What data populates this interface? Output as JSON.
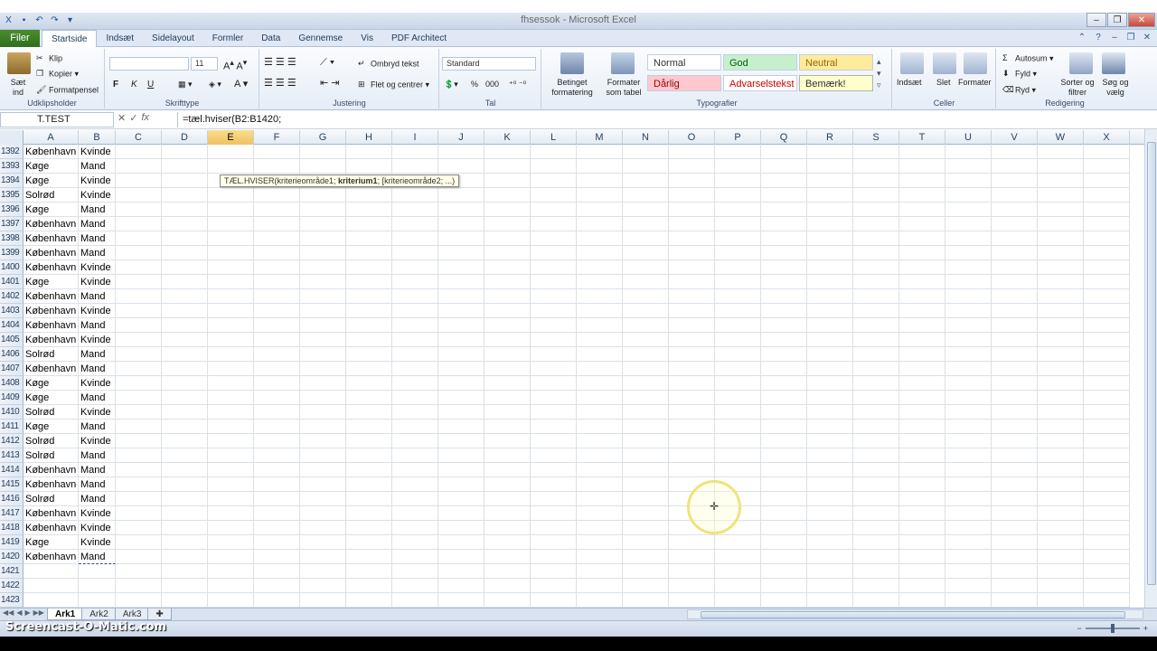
{
  "window": {
    "title": "fhsessok - Microsoft Excel",
    "controls": [
      "minimize",
      "restore",
      "close"
    ]
  },
  "ribbon_tabs": {
    "file": "Filer",
    "tabs": [
      "Startside",
      "Indsæt",
      "Sidelayout",
      "Formler",
      "Data",
      "Gennemse",
      "Vis",
      "PDF Architect"
    ],
    "active": "Startside"
  },
  "ribbon": {
    "clipboard": {
      "paste": "Sæt ind",
      "cut": "Klip",
      "copy": "Kopier",
      "format_painter": "Formatpensel",
      "label": "Udklipsholder"
    },
    "font": {
      "name": "",
      "size": "11",
      "bold": "F",
      "italic": "K",
      "underline": "U",
      "label": "Skrifttype"
    },
    "alignment": {
      "wrap": "Ombryd tekst",
      "merge": "Flet og centrer",
      "label": "Justering"
    },
    "number": {
      "format": "Standard",
      "percent": "%",
      "thousands": "000",
      "label": "Tal"
    },
    "styles": {
      "conditional": "Betinget formatering",
      "as_table": "Formater som tabel",
      "normal": "Normal",
      "good": "God",
      "neutral": "Neutral",
      "bad": "Dårlig",
      "warning": "Advarselstekst",
      "note": "Bemærk!",
      "label": "Typografier"
    },
    "cells": {
      "insert": "Indsæt",
      "delete": "Slet",
      "format": "Formater",
      "label": "Celler"
    },
    "editing": {
      "autosum": "Autosum",
      "fill": "Fyld",
      "clear": "Ryd",
      "sort": "Sorter og filtrer",
      "find": "Søg og vælg",
      "label": "Redigering"
    }
  },
  "formula_bar": {
    "name_box": "T.TEST",
    "formula": "=tæl.hviser(B2:B1420;"
  },
  "columns": [
    "A",
    "B",
    "C",
    "D",
    "E",
    "F",
    "G",
    "H",
    "I",
    "J",
    "K",
    "L",
    "M",
    "N",
    "O",
    "P",
    "Q",
    "R",
    "S",
    "T",
    "U",
    "V",
    "W",
    "X"
  ],
  "active_column": "E",
  "rows": [
    {
      "n": "1392",
      "a": "København",
      "b": "Kvinde"
    },
    {
      "n": "1393",
      "a": "Køge",
      "b": "Mand"
    },
    {
      "n": "1394",
      "a": "Køge",
      "b": "Kvinde"
    },
    {
      "n": "1395",
      "a": "Solrød",
      "b": "Kvinde"
    },
    {
      "n": "1396",
      "a": "Køge",
      "b": "Mand"
    },
    {
      "n": "1397",
      "a": "København",
      "b": "Mand"
    },
    {
      "n": "1398",
      "a": "København",
      "b": "Mand"
    },
    {
      "n": "1399",
      "a": "København",
      "b": "Mand"
    },
    {
      "n": "1400",
      "a": "København",
      "b": "Kvinde"
    },
    {
      "n": "1401",
      "a": "Køge",
      "b": "Kvinde"
    },
    {
      "n": "1402",
      "a": "København",
      "b": "Mand"
    },
    {
      "n": "1403",
      "a": "København",
      "b": "Kvinde"
    },
    {
      "n": "1404",
      "a": "København",
      "b": "Mand"
    },
    {
      "n": "1405",
      "a": "København",
      "b": "Kvinde"
    },
    {
      "n": "1406",
      "a": "Solrød",
      "b": "Mand"
    },
    {
      "n": "1407",
      "a": "København",
      "b": "Mand"
    },
    {
      "n": "1408",
      "a": "Køge",
      "b": "Kvinde"
    },
    {
      "n": "1409",
      "a": "Køge",
      "b": "Mand"
    },
    {
      "n": "1410",
      "a": "Solrød",
      "b": "Kvinde"
    },
    {
      "n": "1411",
      "a": "Køge",
      "b": "Mand"
    },
    {
      "n": "1412",
      "a": "Solrød",
      "b": "Kvinde"
    },
    {
      "n": "1413",
      "a": "Solrød",
      "b": "Mand"
    },
    {
      "n": "1414",
      "a": "København",
      "b": "Mand"
    },
    {
      "n": "1415",
      "a": "København",
      "b": "Mand"
    },
    {
      "n": "1416",
      "a": "Solrød",
      "b": "Mand"
    },
    {
      "n": "1417",
      "a": "København",
      "b": "Kvinde"
    },
    {
      "n": "1418",
      "a": "København",
      "b": "Kvinde"
    },
    {
      "n": "1419",
      "a": "Køge",
      "b": "Kvinde"
    },
    {
      "n": "1420",
      "a": "København",
      "b": "Mand"
    },
    {
      "n": "1421",
      "a": "",
      "b": ""
    },
    {
      "n": "1422",
      "a": "",
      "b": ""
    },
    {
      "n": "1423",
      "a": "",
      "b": ""
    }
  ],
  "tooltip": {
    "prefix": "TÆL.HVISER(kriterieområde1; ",
    "bold": "kriterium1",
    "suffix": "; [kriterieområde2; ...)"
  },
  "sheets": {
    "tabs": [
      "Ark1",
      "Ark2",
      "Ark3"
    ],
    "active": "Ark1"
  },
  "watermark": "Screencast-O-Matic.com",
  "colors": {
    "accent": "#2f6e1c",
    "active_col": "#f1c15f",
    "grid": "#dbe1e8"
  }
}
